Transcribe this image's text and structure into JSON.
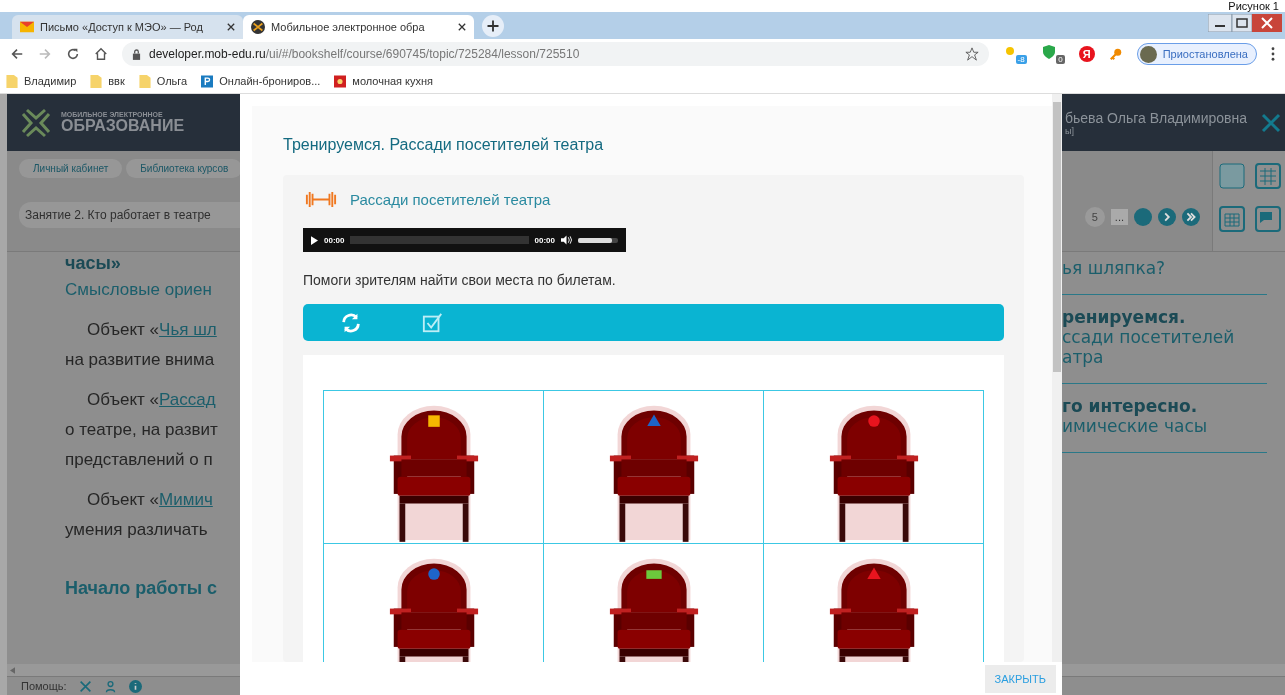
{
  "corner_caption": "Рисунок 1",
  "browser": {
    "tabs": [
      {
        "title": "Письмо «Доступ к МЭО» — Род",
        "kind": "mail",
        "selected": false
      },
      {
        "title": "Мобильное электронное обра",
        "kind": "site",
        "selected": true
      }
    ],
    "url_host": "developer.mob-edu.ru",
    "url_path": "/ui/#/bookshelf/course/690745/topic/725284/lesson/725510",
    "extension_badges": [
      "-8",
      "0"
    ],
    "yandex_label": "Я",
    "profile": "Приостановлена",
    "bookmarks": [
      {
        "label": "Владимир",
        "kind": "folder"
      },
      {
        "label": "ввк",
        "kind": "folder"
      },
      {
        "label": "Ольга",
        "kind": "folder"
      },
      {
        "label": "Онлайн-брониров...",
        "kind": "p"
      },
      {
        "label": "молочная кухня",
        "kind": "red"
      }
    ]
  },
  "app": {
    "logo_small": "МОБИЛЬНОЕ ЭЛЕКТРОННОЕ",
    "logo_big": "ОБРАЗОВАНИЕ",
    "user_name": "бьева Ольга Владимировна",
    "user_sub": "ы]",
    "breadcrumbs": [
      "Личный кабинет",
      "Библиотека курсов"
    ],
    "lesson_select": "Занятие 2. Кто работает в театре",
    "pager": [
      "5",
      "..."
    ],
    "content_heading": "часы»",
    "content_subtitle": "Смысловые ориен",
    "paragraphs": [
      {
        "lead": "Объект «",
        "link": "Чья шл",
        "rest": [
          "на развитие внима"
        ]
      },
      {
        "lead": "Объект «",
        "link": "Рассад",
        "rest": [
          "о театре, на развит",
          "представлений о п"
        ]
      },
      {
        "lead": "Объект «",
        "link": "Мимич",
        "rest": [
          "умения различать"
        ]
      }
    ],
    "section_heading": "Начало работы с",
    "menu": [
      {
        "lines": [
          "ья шляпка?"
        ]
      },
      {
        "heading": "ренируемся.",
        "lines": [
          "ссади посетителей",
          "атра"
        ]
      },
      {
        "heading": "го интересно.",
        "lines": [
          "имические часы"
        ]
      }
    ],
    "help_label": "Помощь:"
  },
  "modal": {
    "title": "Тренируемся. Рассади посетителей театра",
    "card_title": "Рассади посетителей театра",
    "audio": {
      "current": "00:00",
      "duration": "00:00",
      "volume": {
        "level": 0.85
      }
    },
    "instruction": "Помоги зрителям найти свои места по билетам.",
    "seats": [
      {
        "kind": "square",
        "color": "#f5b700"
      },
      {
        "kind": "triangle",
        "color": "#1e64c8"
      },
      {
        "kind": "circle",
        "color": "#e8141e"
      },
      {
        "kind": "circle",
        "color": "#1e64c8"
      },
      {
        "kind": "bar",
        "color": "#6cc83c"
      },
      {
        "kind": "triangle",
        "color": "#e8141e"
      }
    ],
    "close_button": "ЗАКРЫТЬ"
  }
}
